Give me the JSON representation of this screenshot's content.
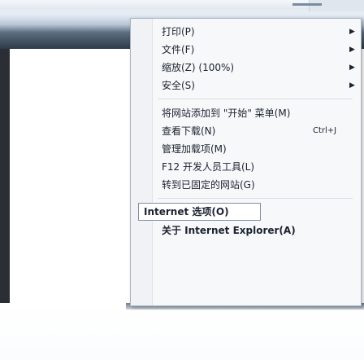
{
  "menu": {
    "items": [
      {
        "label": "打印(P)",
        "submenu": true
      },
      {
        "label": "文件(F)",
        "submenu": true
      },
      {
        "label": "缩放(Z) (100%)",
        "submenu": true
      },
      {
        "label": "安全(S)",
        "submenu": true
      },
      {
        "label": "将网站添加到 \"开始\" 菜单(M)",
        "submenu": false
      },
      {
        "label": "查看下载(N)",
        "shortcut": "Ctrl+J",
        "submenu": false
      },
      {
        "label": "管理加载项(M)",
        "submenu": false
      },
      {
        "label": "F12 开发人员工具(L)",
        "submenu": false
      },
      {
        "label": "转到已固定的网站(G)",
        "submenu": false
      },
      {
        "label": "Internet 选项(O)",
        "submenu": false,
        "highlighted": true
      },
      {
        "label": "关于 Internet Explorer(A)",
        "submenu": false
      }
    ]
  },
  "icons": {
    "star": "star-icon",
    "close": "close-icon",
    "arrow": "chevron-right-icon"
  },
  "colors": {
    "menu_bg": "#f7f8fa",
    "menu_border": "#a9b3c0",
    "highlight_border": "#7d8fa6",
    "chrome_dark": "#2e3a47"
  }
}
